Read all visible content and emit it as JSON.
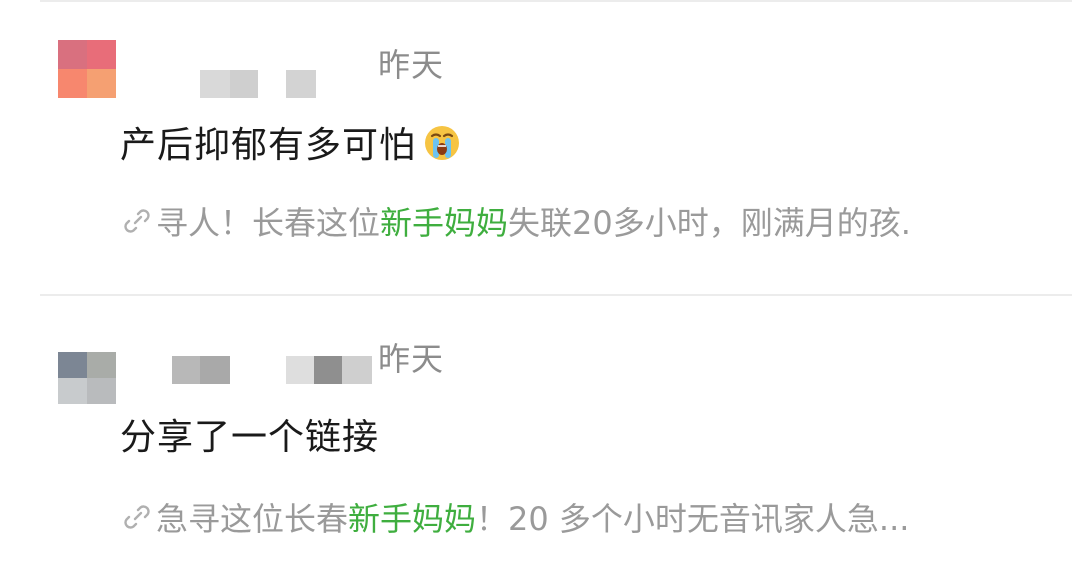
{
  "feed": {
    "posts": [
      {
        "time": "昨天",
        "content": "产后抑郁有多可怕",
        "emoji": "crying-face-icon",
        "link": {
          "icon": "link-icon",
          "before": "寻人！长春这位",
          "highlight": "新手妈妈",
          "after": "失联20多小时，刚满月的孩."
        }
      },
      {
        "time": "昨天",
        "content": "分享了一个链接",
        "link": {
          "icon": "link-icon",
          "before": "急寻这位长春",
          "highlight": "新手妈妈",
          "after": "！20 多个小时无音讯家人急..."
        }
      }
    ]
  },
  "colors": {
    "highlight": "#3fae3f",
    "muted_text": "#9a9a9a",
    "time_text": "#8c8c8c",
    "main_text": "#1a1a1a",
    "divider": "#ececec"
  }
}
